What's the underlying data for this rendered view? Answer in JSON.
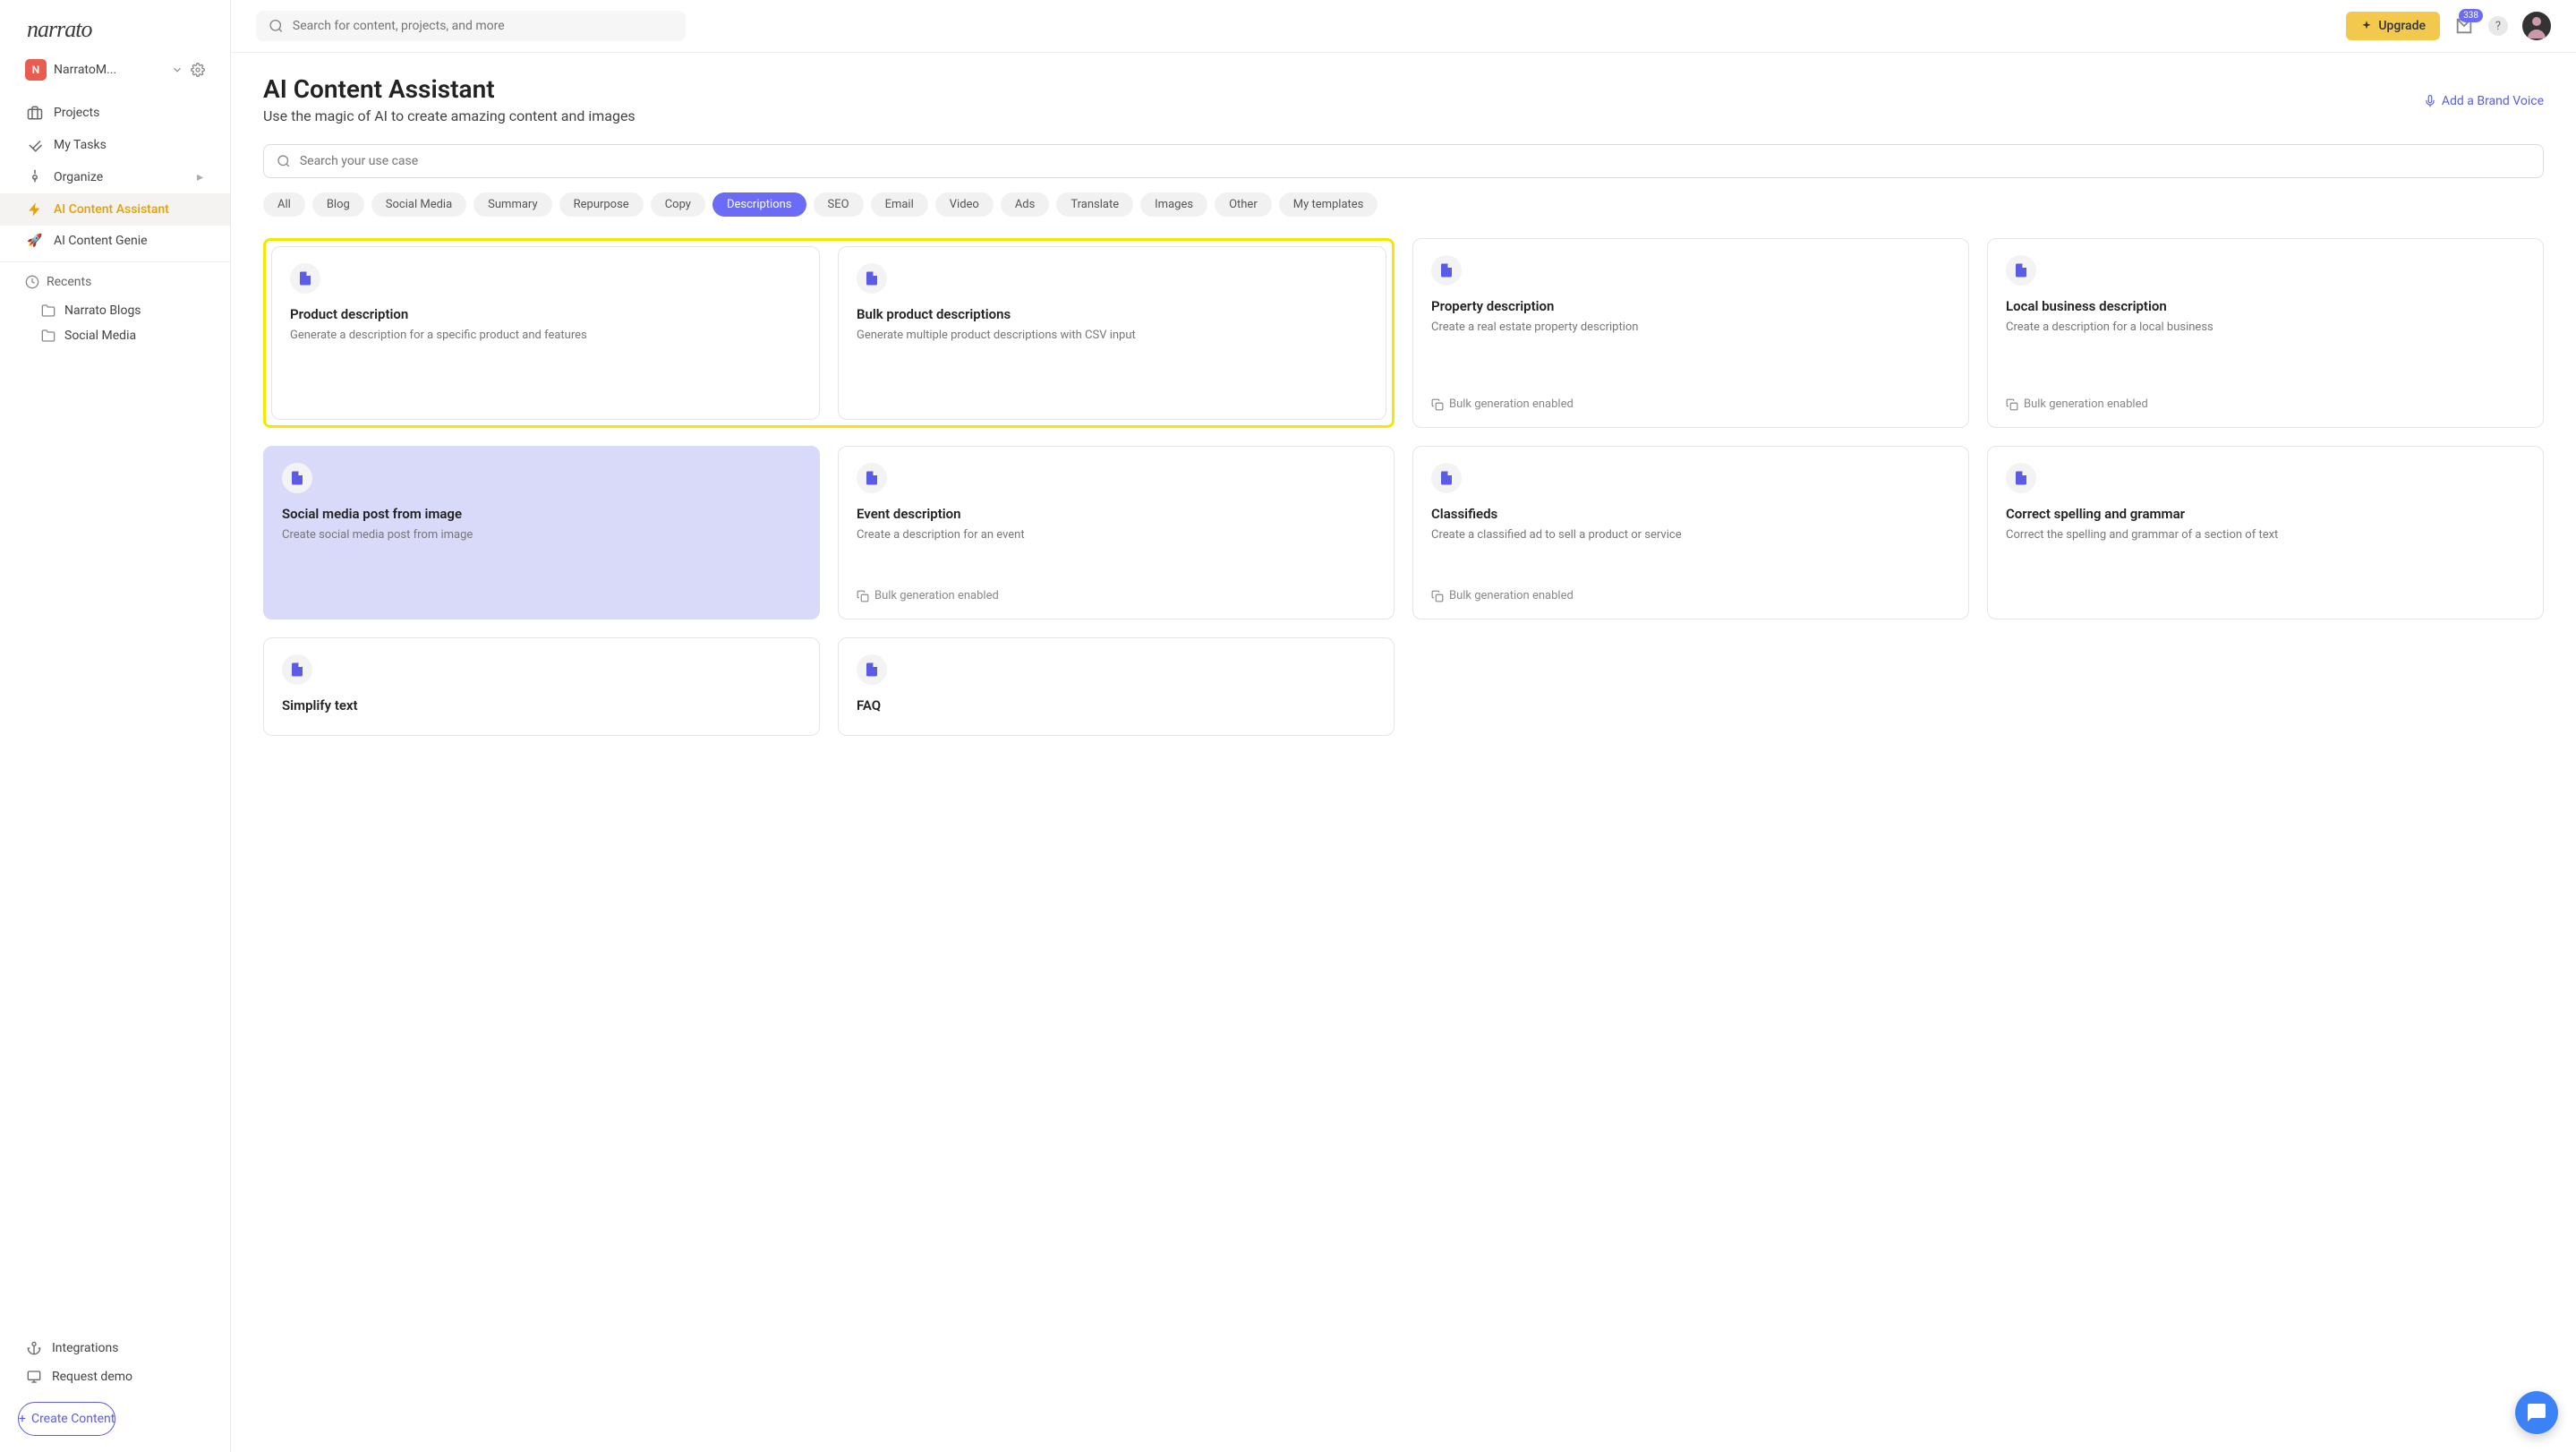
{
  "logo": "narrato",
  "workspace": {
    "letter": "N",
    "name": "NarratoM..."
  },
  "nav": [
    {
      "label": "Projects",
      "id": "projects"
    },
    {
      "label": "My Tasks",
      "id": "my-tasks"
    },
    {
      "label": "Organize",
      "id": "organize"
    },
    {
      "label": "AI Content Assistant",
      "id": "ai-assistant",
      "active": true
    },
    {
      "label": "AI Content Genie",
      "id": "ai-genie",
      "emoji": "🚀"
    }
  ],
  "recents_label": "Recents",
  "recents": [
    {
      "label": "Narrato Blogs"
    },
    {
      "label": "Social Media"
    }
  ],
  "integrations_label": "Integrations",
  "request_demo_label": "Request demo",
  "create_content_label": "Create Content",
  "search_placeholder": "Search for content, projects, and more",
  "upgrade_label": "Upgrade",
  "notif_count": "338",
  "page_title": "AI Content Assistant",
  "page_subtitle": "Use the magic of AI to create amazing content and images",
  "brand_voice_label": "Add a Brand Voice",
  "usecase_placeholder": "Search your use case",
  "pills": [
    "All",
    "Blog",
    "Social Media",
    "Summary",
    "Repurpose",
    "Copy",
    "Descriptions",
    "SEO",
    "Email",
    "Video",
    "Ads",
    "Translate",
    "Images",
    "Other",
    "My templates"
  ],
  "active_pill": "Descriptions",
  "bulk_label": "Bulk generation enabled",
  "cards": {
    "c1": {
      "title": "Product description",
      "desc": "Generate a description for a specific product and features"
    },
    "c2": {
      "title": "Bulk product descriptions",
      "desc": "Generate multiple product descriptions with CSV input"
    },
    "c3": {
      "title": "Property description",
      "desc": "Create a real estate property description",
      "bulk": true
    },
    "c4": {
      "title": "Local business description",
      "desc": "Create a description for a local business",
      "bulk": true
    },
    "c5": {
      "title": "Social media post from image",
      "desc": "Create social media post from image"
    },
    "c6": {
      "title": "Event description",
      "desc": "Create a description for an event",
      "bulk": true
    },
    "c7": {
      "title": "Classifieds",
      "desc": "Create a classified ad to sell a product or service",
      "bulk": true
    },
    "c8": {
      "title": "Correct spelling and grammar",
      "desc": "Correct the spelling and grammar of a section of text"
    },
    "c9": {
      "title": "Simplify text",
      "desc": ""
    },
    "c10": {
      "title": "FAQ",
      "desc": ""
    }
  }
}
